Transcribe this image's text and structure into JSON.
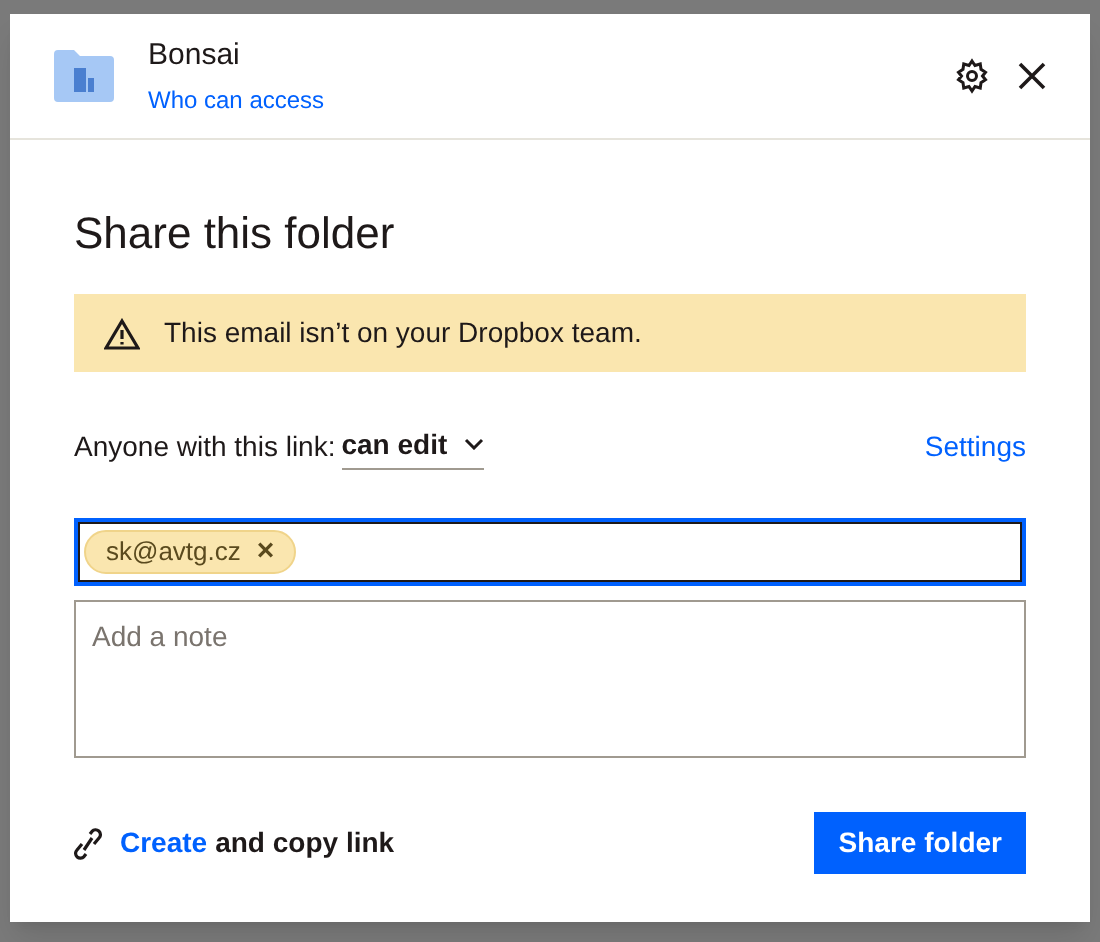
{
  "header": {
    "title": "Bonsai",
    "link": "Who can access"
  },
  "heading": "Share this folder",
  "warning": "This email isn’t on your Dropbox team.",
  "link_access": {
    "label": "Anyone with this link:",
    "permission": "can edit",
    "settings": "Settings"
  },
  "recipients": {
    "focused": true,
    "chips": [
      {
        "text": "sk@avtg.cz",
        "remove": "×"
      }
    ]
  },
  "note": {
    "placeholder": "Add a note"
  },
  "footer": {
    "link": "Create",
    "text": "and copy link",
    "button": "Share folder"
  }
}
